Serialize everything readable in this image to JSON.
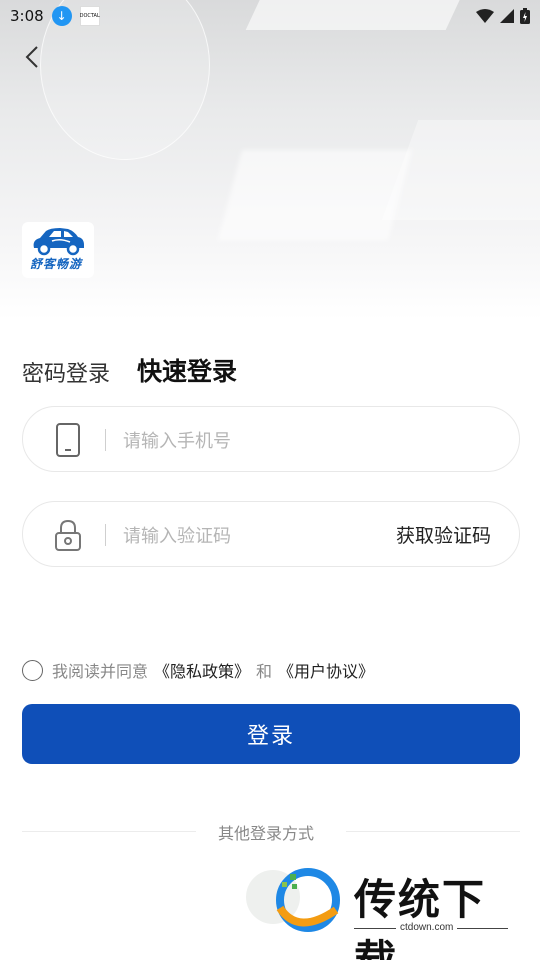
{
  "status_bar": {
    "time": "3:08",
    "app_icon_text": "DOCTAL"
  },
  "app": {
    "logo_text": "舒客畅游",
    "brand_color": "#1565c0"
  },
  "tabs": {
    "password_login": "密码登录",
    "quick_login": "快速登录"
  },
  "phone_field": {
    "placeholder": "请输入手机号",
    "icon": "phone-icon"
  },
  "code_field": {
    "placeholder": "请输入验证码",
    "icon": "lock-icon",
    "get_code_label": "获取验证码"
  },
  "agreement": {
    "prefix": "我阅读并同意",
    "privacy": "《隐私政策》",
    "and": "和",
    "user_agreement": "《用户协议》",
    "checked": false
  },
  "login_button": {
    "label": "登录",
    "color": "#0f4fb8"
  },
  "other_login": {
    "label": "其他登录方式"
  },
  "watermark": {
    "title": "传统下载",
    "url": "ctdown.com"
  }
}
